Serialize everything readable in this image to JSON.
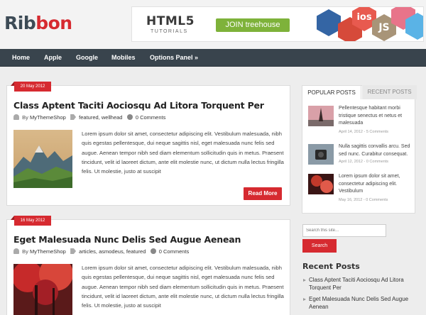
{
  "site": {
    "logo_part1": "Rib",
    "logo_part2": "bon"
  },
  "banner": {
    "headline": "HTML5",
    "subline": "TUTORIALS",
    "cta": "JOIN treehouse",
    "hex_labels": [
      "ios",
      "JS"
    ]
  },
  "nav": {
    "items": [
      "Home",
      "Apple",
      "Google",
      "Mobiles",
      "Options Panel »"
    ]
  },
  "posts": [
    {
      "date": "20 May 2012",
      "title": "Class Aptent Taciti Aociosqu Ad Litora Torquent Per",
      "author_prefix": "By",
      "author": "MyThemeShop",
      "tags": "featured, wellhead",
      "comments": "0 Comments",
      "excerpt": "Lorem ipsum dolor sit amet, consectetur adipiscing elit. Vestibulum malesuada, nibh quis egestas pellentesque, dui neque sagittis nisl, eget malesuada nunc felis sed augue. Aenean tempor nibh sed diam elementum sollicitudin quis in metus. Praesent tincidunt, velit id laoreet dictum, ante elit molestie nunc, ut dictum nulla lectus fringilla felis. Ut molestie, justo at suscipit",
      "read_more": "Read More",
      "thumb_icon": "mountain-landscape"
    },
    {
      "date": "16 May 2012",
      "title": "Eget Malesuada Nunc Delis Sed Augue Aenean",
      "author_prefix": "By",
      "author": "MyThemeShop",
      "tags": "articles, asmodeus, featured",
      "comments": "0 Comments",
      "excerpt": "Lorem ipsum dolor sit amet, consectetur adipiscing elit. Vestibulum malesuada, nibh quis egestas pellentesque, dui neque sagittis nisl, eget malesuada nunc felis sed augue. Aenean tempor nibh sed diam elementum sollicitudin quis in metus. Praesent tincidunt, velit id laoreet dictum, ante elit molestie nunc, ut dictum nulla lectus fringilla felis. Ut molestie, justo at suscipit",
      "thumb_icon": "red-autumn-trees"
    }
  ],
  "sidebar": {
    "tabs": [
      "POPULAR POSTS",
      "RECENT POSTS"
    ],
    "popular": [
      {
        "text": "Pellentesque habitant morbi tristique senectus et netus et malesuada",
        "date": "April 14, 2012 - 5 Comments"
      },
      {
        "text": "Nulla sagittis convallis arcu. Sed sed nunc. Curabitur consequat.",
        "date": "April 12, 2012 - 0 Comments"
      },
      {
        "text": "Lorem ipsum dolor sit amet, consectetur adipiscing elit. Vestibulum",
        "date": "May 16, 2012 - 0 Comments"
      }
    ],
    "search": {
      "placeholder": "Search this site...",
      "button": "Search"
    },
    "recent_title": "Recent Posts",
    "recent": [
      "Class Aptent Taciti Aociosqu Ad Litora Torquent Per",
      "Eget Malesuada Nunc Delis Sed Augue Aenean"
    ]
  },
  "colors": {
    "accent": "#d62a30",
    "nav": "#39444d",
    "logo": "#3d4b56",
    "banner_button": "#7eb23a"
  }
}
